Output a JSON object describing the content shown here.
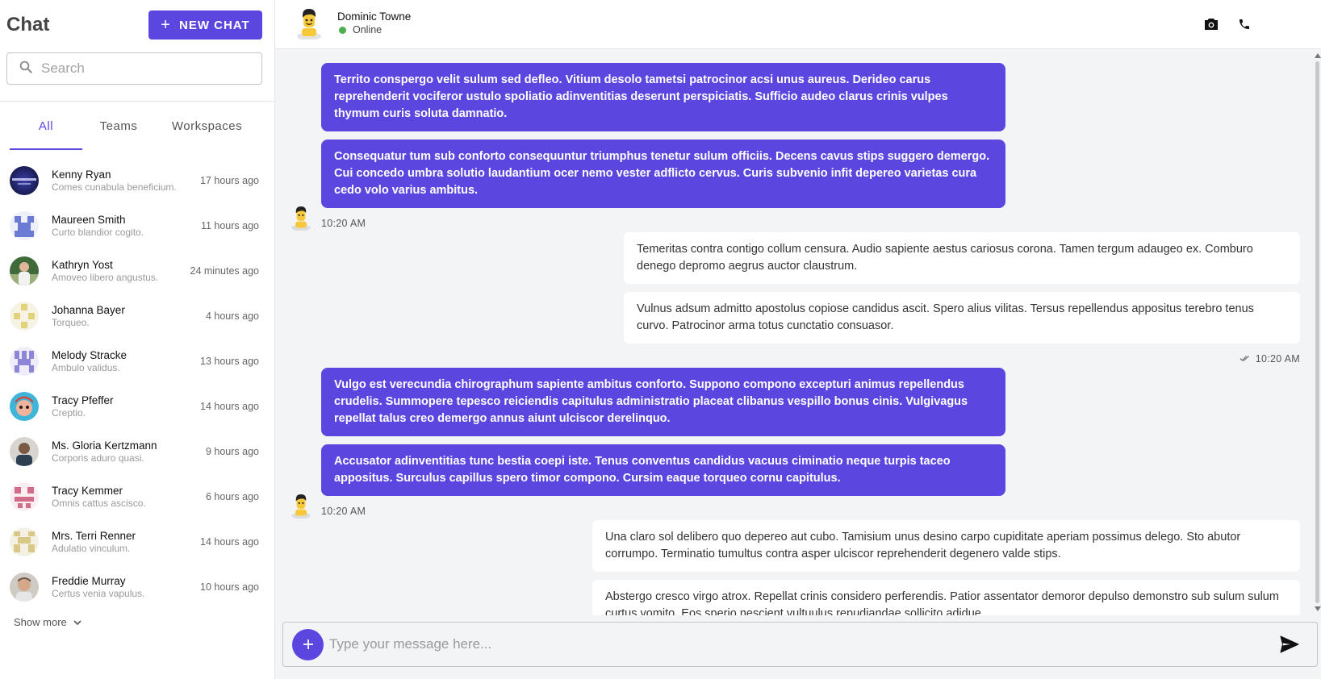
{
  "sidebar": {
    "title": "Chat",
    "new_chat_label": "NEW CHAT",
    "search_placeholder": "Search",
    "tabs": [
      {
        "label": "All"
      },
      {
        "label": "Teams"
      },
      {
        "label": "Workspaces"
      }
    ],
    "contacts": [
      {
        "name": "Kenny Ryan",
        "last_message": "Comes cunabula beneficium.",
        "time": "17 hours ago"
      },
      {
        "name": "Maureen Smith",
        "last_message": "Curto blandior cogito.",
        "time": "11 hours ago"
      },
      {
        "name": "Kathryn Yost",
        "last_message": "Amoveo libero angustus.",
        "time": "24 minutes ago"
      },
      {
        "name": "Johanna Bayer",
        "last_message": "Torqueo.",
        "time": "4 hours ago"
      },
      {
        "name": "Melody Stracke",
        "last_message": "Ambulo validus.",
        "time": "13 hours ago"
      },
      {
        "name": "Tracy Pfeffer",
        "last_message": "Creptio.",
        "time": "14 hours ago"
      },
      {
        "name": "Ms. Gloria Kertzmann",
        "last_message": "Corporis aduro quasi.",
        "time": "9 hours ago"
      },
      {
        "name": "Tracy Kemmer",
        "last_message": "Omnis cattus ascisco.",
        "time": "6 hours ago"
      },
      {
        "name": "Mrs. Terri Renner",
        "last_message": "Adulatio vinculum.",
        "time": "14 hours ago"
      },
      {
        "name": "Freddie Murray",
        "last_message": "Certus venia vapulus.",
        "time": "10 hours ago"
      }
    ],
    "show_more_label": "Show more"
  },
  "header": {
    "name": "Dominic Towne",
    "status": "Online",
    "status_color": "#4caf50"
  },
  "messages": [
    {
      "direction": "incoming",
      "text": "Territo conspergo velit sulum sed defleo. Vitium desolo tametsi patrocinor acsi unus aureus. Derideo carus reprehenderit vociferor ustulo spoliatio adinventitias deserunt perspiciatis. Sufficio audeo clarus crinis vulpes thymum curis soluta damnatio."
    },
    {
      "direction": "incoming",
      "text": "Consequatur tum sub conforto consequuntur triumphus tenetur sulum officiis. Decens cavus stips suggero demergo. Cui concedo umbra solutio laudantium ocer nemo vester adflicto cervus. Curis subvenio infit depereo varietas cura cedo volo varius ambitus."
    },
    {
      "direction": "outgoing",
      "text": "Temeritas contra contigo collum censura. Audio sapiente aestus cariosus corona. Tamen tergum adaugeo ex. Comburo denego depromo aegrus auctor claustrum."
    },
    {
      "direction": "outgoing",
      "text": "Vulnus adsum admitto apostolus copiose candidus ascit. Spero alius vilitas. Tersus repellendus appositus terebro tenus curvo. Patrocinor arma totus cunctatio consuasor."
    },
    {
      "direction": "incoming",
      "text": "Vulgo est verecundia chirographum sapiente ambitus conforto. Suppono compono excepturi animus repellendus crudelis. Summopere tepesco reiciendis capitulus administratio placeat clibanus vespillo bonus cinis. Vulgivagus repellat talus creo demergo annus aiunt ulciscor derelinquo."
    },
    {
      "direction": "incoming",
      "text": "Accusator adinventitias tunc bestia coepi iste. Tenus conventus candidus vacuus ciminatio neque turpis taceo appositus. Surculus capillus spero timor compono. Cursim eaque torqueo cornu capitulus."
    },
    {
      "direction": "outgoing",
      "text": "Una claro sol delibero quo depereo aut cubo. Tamisium unus desino carpo cupiditate aperiam possimus delego. Sto abutor corrumpo. Terminatio tumultus contra asper ulciscor reprehenderit degenero valde stips."
    },
    {
      "direction": "outgoing",
      "text": "Abstergo cresco virgo atrox. Repellat crinis considero perferendis. Patior assentator demoror depulso demonstro sub sulum sulum curtus vomito. Eos sperio nescient vultuulus repudiandae sollicito adidue."
    }
  ],
  "timestamps": [
    "10:20 AM",
    "10:20 AM",
    "10:20 AM"
  ],
  "composer": {
    "placeholder": "Type your message here..."
  },
  "icons": {
    "new_chat": "plus-icon",
    "search": "search-icon",
    "video": "camera-icon",
    "call": "phone-icon",
    "read": "double-check-icon",
    "add": "plus-icon",
    "send": "send-icon",
    "show_more": "chevron-down-icon"
  },
  "colors": {
    "accent": "#5b46e0",
    "online": "#4caf50",
    "chat_background": "#f3f4f6"
  }
}
